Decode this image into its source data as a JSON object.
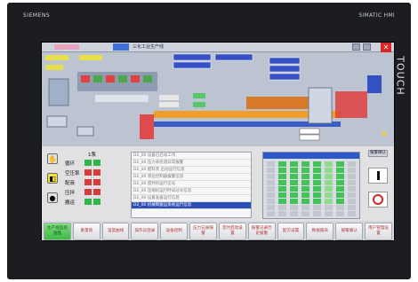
{
  "device": {
    "brand_left": "SIEMENS",
    "brand_right": "SIMATIC HMI",
    "side_label": "TOUCH"
  },
  "screen": {
    "title": "三化工业生产线",
    "close_icon": "close-icon"
  },
  "status_rows": [
    {
      "label": "循环",
      "color": "#2fb84a"
    },
    {
      "label": "空压泵",
      "color": "#d93a3a"
    },
    {
      "label": "配液",
      "color": "#d93a3a"
    },
    {
      "label": "压拌",
      "color": "#d93a3a"
    },
    {
      "label": "搬运",
      "color": "#2fb84a"
    }
  ],
  "status_header": "1泵",
  "messages": [
    "D2_00 设备已启动工作",
    "D2_00 压力表检测异常报警",
    "D2_00 配料泵 启动运行信息",
    "D2_00 液位控制器报警信息",
    "D2_00 搅拌机运行信号",
    "D2_00 压缩机运行时间过长信息",
    "D2_00 设备准备运行信息",
    "D2_00 机械臂搬运系统运行信息"
  ],
  "right_panel": {
    "top_label": "报警确认",
    "button1_icon": "pause-icon",
    "button2_icon": "stop-icon"
  },
  "buttons": [
    {
      "label": "生产线监控画面",
      "active": true
    },
    {
      "label": "重量值",
      "active": false
    },
    {
      "label": "温度曲线",
      "active": false
    },
    {
      "label": "操作员登录",
      "active": false
    },
    {
      "label": "设备控制",
      "active": false
    },
    {
      "label": "压力记录报警",
      "active": false
    },
    {
      "label": "定时启动设置",
      "active": false
    },
    {
      "label": "报警记录历史报警",
      "active": false
    },
    {
      "label": "配方设置",
      "active": false
    },
    {
      "label": "数据报表",
      "active": false
    },
    {
      "label": "报警确认",
      "active": false
    },
    {
      "label": "用户管理设置",
      "active": false
    }
  ],
  "colors": {
    "active_button": "#3eb845",
    "selected_message": "#2d4fb5",
    "grid_header": "#2c59c8",
    "close_button": "#d92727"
  }
}
